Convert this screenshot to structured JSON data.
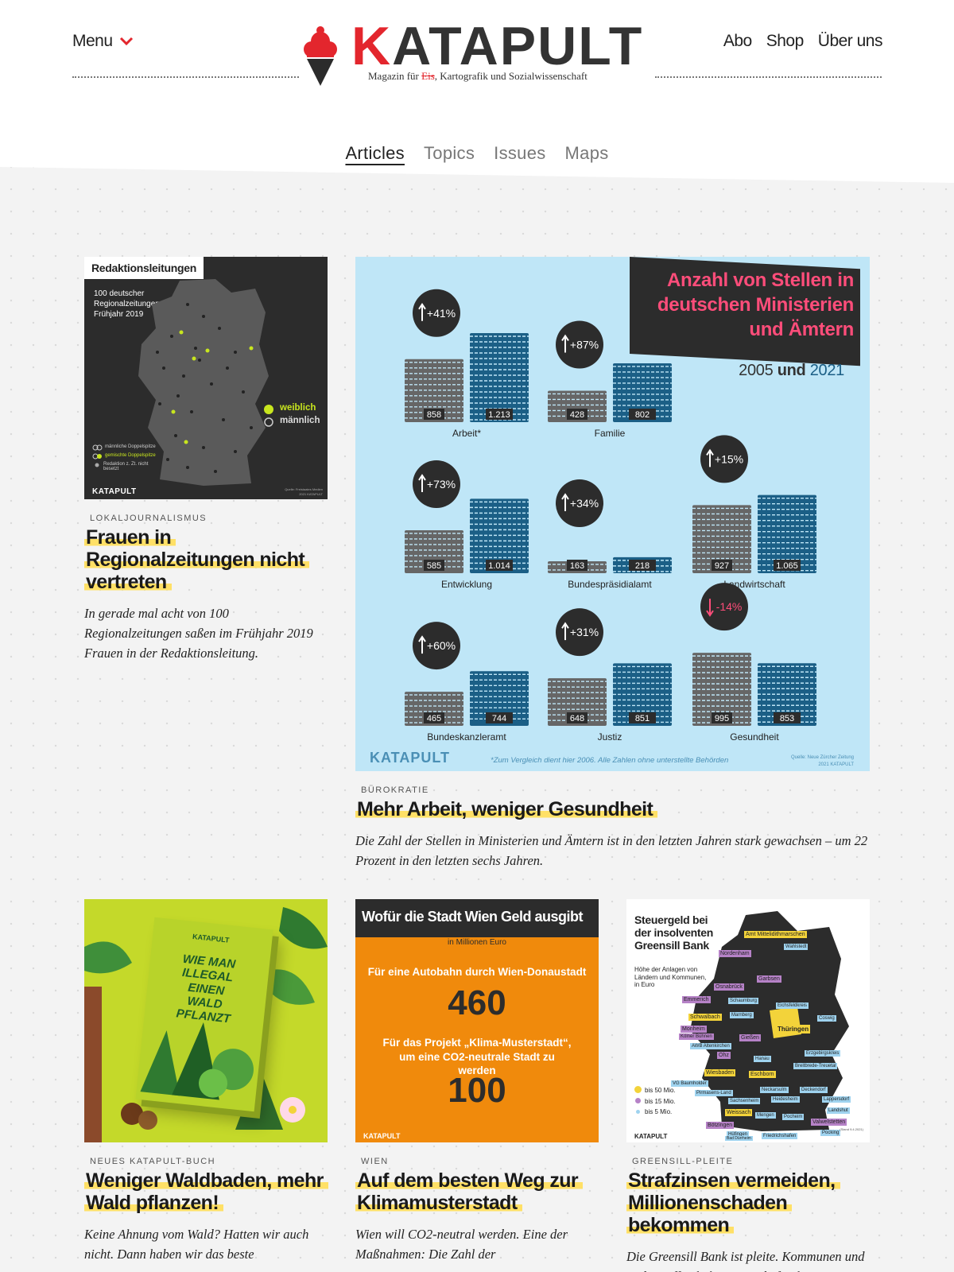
{
  "header": {
    "menu_label": "Menu",
    "logo": {
      "k": "K",
      "rest": "ATAPULT",
      "sub_before": "Magazin für ",
      "sub_struck": "Eis",
      "sub_after": ", Kartografik und Sozialwissenschaft"
    },
    "nav": [
      {
        "label": "Abo"
      },
      {
        "label": "Shop"
      },
      {
        "label": "Über uns"
      }
    ]
  },
  "tabs": [
    {
      "label": "Articles",
      "active": true
    },
    {
      "label": "Topics"
    },
    {
      "label": "Issues"
    },
    {
      "label": "Maps"
    }
  ],
  "colors": {
    "accent": "#e3262d",
    "highlight": "#ffe066",
    "chart_bg": "#bfe6f7",
    "series_2005": "#666666",
    "series_2021": "#1b5f86"
  },
  "articles": [
    {
      "category": "Lokaljournalismus",
      "title": "Frauen in Regionalzeitungen nicht vertreten",
      "teaser": "In gerade mal acht von 100 Regionalzeitungen saßen im Frühjahr 2019 Frauen in der Redaktionsleitung.",
      "image": {
        "heading": "Redaktionsleitungen",
        "subheading": "100 deutscher Regionalzeitungen, Frühjahr 2019",
        "legend": [
          "weiblich",
          "männlich"
        ],
        "small_legend": [
          "männliche Doppelspitze",
          "gemischte Doppelspitze",
          "Redaktion z. Zt. nicht besetzt"
        ],
        "brand": "KATAPULT",
        "source": "Quelle: Freistaates Medien",
        "copyright": "2021 KATAPULT"
      }
    },
    {
      "category": "Bürokratie",
      "title": "Mehr Arbeit, weniger Gesundheit",
      "teaser": "Die Zahl der Stellen in Ministerien und Ämtern ist in den letzten Jahren stark gewachsen – um 22 Prozent in den letzten sechs Jahren.",
      "image": {
        "footnote": "*Zum Vergleich dient hier 2006. Alle Zahlen ohne unterstellte Behörden",
        "brand": "KATAPULT",
        "source": "Quelle: Neue Zürcher Zeitung",
        "copyright": "2021 KATAPULT"
      }
    },
    {
      "category": "Neues KATAPULT-Buch",
      "title": "Weniger Waldbaden, mehr Wald pflanzen!",
      "teaser": "Keine Ahnung vom Wald? Hatten wir auch nicht. Dann haben wir das beste",
      "image": {
        "book_brand": "KATAPULT",
        "book_title": [
          "WIE MAN",
          "ILLEGAL",
          "EINEN",
          "WALD",
          "PFLANZT"
        ]
      }
    },
    {
      "category": "Wien",
      "title": "Auf dem besten Weg zur Klimamusterstadt",
      "teaser": "Wien will CO2-neutral werden. Eine der Maßnahmen: Die Zahl der",
      "image": {
        "heading": "Wofür die Stadt Wien Geld ausgibt",
        "unit": "in Millionen Euro",
        "item1_label": "Für eine Autobahn durch Wien-Donaustadt",
        "item1_value": "460",
        "item2_label": "Für das Projekt „Klima-Musterstadt“, um eine CO2-neutrale Stadt zu werden",
        "item2_value": "100",
        "brand": "KATAPULT"
      }
    },
    {
      "category": "Greensill-Pleite",
      "title": "Strafzinsen vermeiden, Millionenschaden bekommen",
      "teaser": "Die Greensill Bank ist pleite. Kommunen und andere öffentliche Träger befürchten",
      "image": {
        "heading": "Steuergeld bei der insolventen Greensill Bank",
        "sub": "Höhe der Anlagen von Ländern und Kommunen, in Euro",
        "legend": [
          "bis 50 Mio.",
          "bis 15 Mio.",
          "bis 5 Mio."
        ],
        "places_yellow": [
          "Amt Mittelidithmarschen",
          "Thüringen",
          "Schwalbach",
          "Wiesbaden",
          "Eschborn",
          "Weissach"
        ],
        "places_purple": [
          "Nordenham",
          "Osnabrück",
          "Garbsen",
          "Emmerich",
          "Monheim",
          "Kölner Bühnen",
          "Gießen",
          "Ohz",
          "Bötzingen",
          "Valwelstetten"
        ],
        "places_blue": [
          "Wahlstedt",
          "Schaumburg",
          "Eichsfeldkreis",
          "Marnberg",
          "Coswig",
          "AWB Altenkirchen",
          "Hanau",
          "Erzgebirgskreis",
          "Breitbrede-Treuetal",
          "VG Baumholder",
          "Pirmasens-Land",
          "Sachsenheim",
          "Neckarsulm",
          "Heidesheim",
          "Deckendorf",
          "Lappersdorf",
          "Landshut",
          "Mengen",
          "Pocheim",
          "Pocking",
          "Hüfingen",
          "Bad Dürrheim",
          "Friedrichshafen"
        ],
        "brand": "KATAPULT",
        "date": "(Stand 9.4.2021)"
      }
    }
  ],
  "chart_data": {
    "type": "bar",
    "title": "Anzahl von Stellen in deutschen Ministerien und Ämtern",
    "subtitle_a": "2005",
    "subtitle_mid": " und ",
    "subtitle_b": "2021",
    "series": [
      {
        "name": "2005"
      },
      {
        "name": "2021"
      }
    ],
    "categories": [
      "Arbeit*",
      "Familie",
      "Entwicklung",
      "Bundespräsidialamt",
      "Landwirtschaft",
      "Bundeskanzleramt",
      "Justiz",
      "Gesundheit"
    ],
    "values_2005": [
      858,
      428,
      585,
      163,
      927,
      465,
      648,
      995
    ],
    "values_2021": [
      1213,
      802,
      1014,
      218,
      1065,
      744,
      851,
      853
    ],
    "labels_2005": [
      "858",
      "428",
      "585",
      "163",
      "927",
      "465",
      "648",
      "995"
    ],
    "labels_2021": [
      "1.213",
      "802",
      "1.014",
      "218",
      "1.065",
      "744",
      "851",
      "853"
    ],
    "changes": [
      "+41%",
      "+87%",
      "+73%",
      "+34%",
      "+15%",
      "+60%",
      "+31%",
      "-14%"
    ],
    "change_up": [
      true,
      true,
      true,
      true,
      true,
      true,
      true,
      false
    ]
  }
}
